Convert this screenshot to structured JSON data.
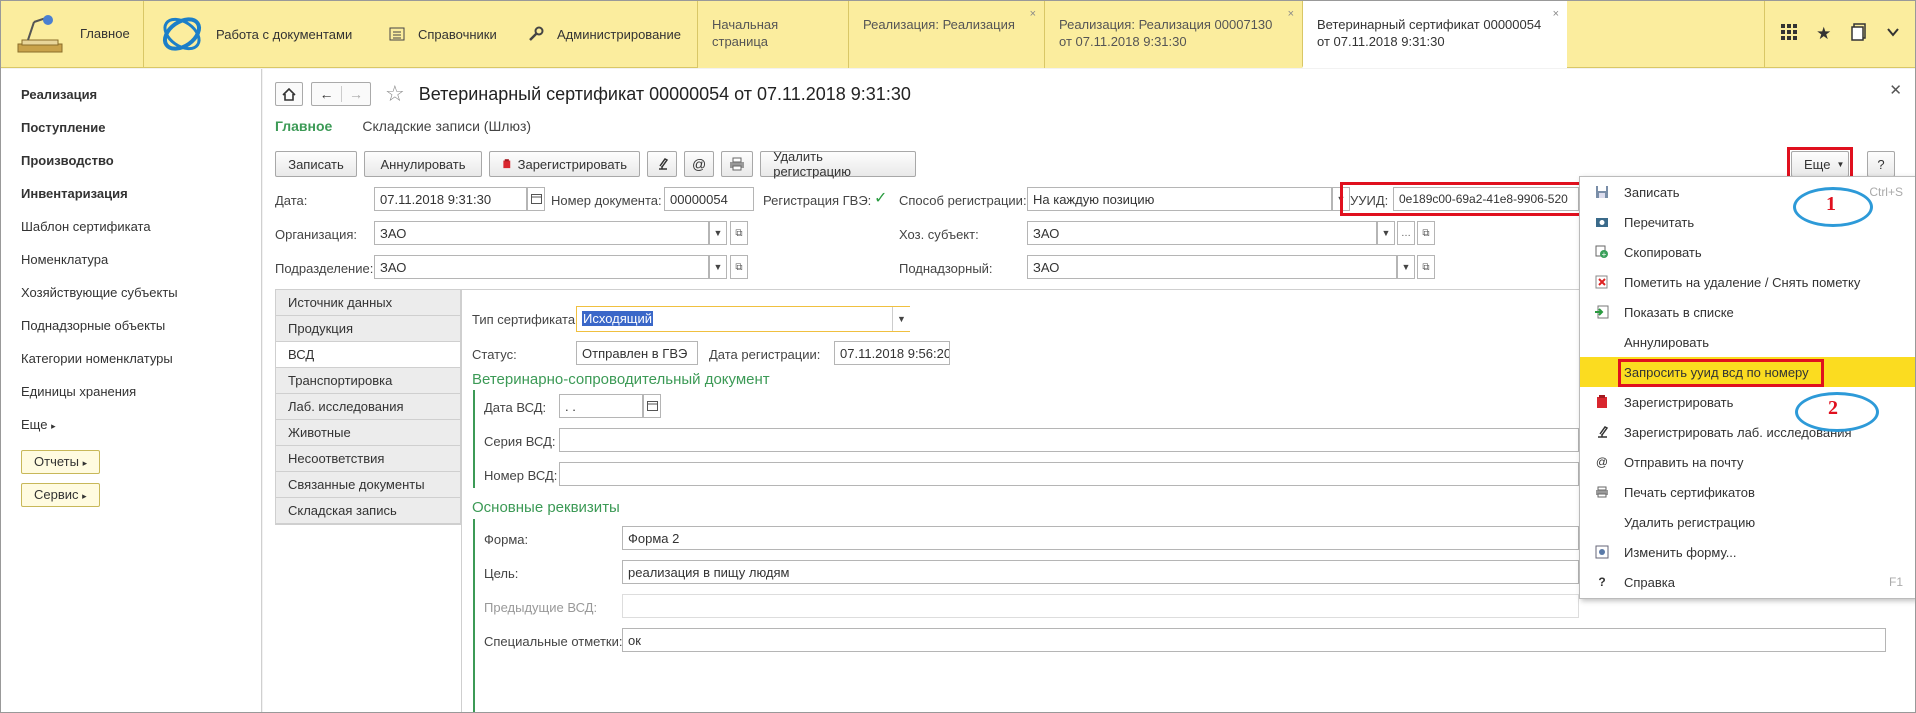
{
  "topbar": {
    "home_label": "Главное",
    "sections": [
      {
        "label": "Работа с документами",
        "icon": "orbit-logo-icon"
      },
      {
        "label": "Справочники",
        "icon": "list-icon"
      },
      {
        "label": "Администрирование",
        "icon": "wrench-icon"
      }
    ],
    "tabs": [
      {
        "label": "Начальная страница",
        "sub": ""
      },
      {
        "label": "Реализация: Реализация",
        "sub": ""
      },
      {
        "label": "Реализация: Реализация 00007130",
        "sub": "от 07.11.2018 9:31:30"
      },
      {
        "label": "Ветеринарный сертификат 00000054",
        "sub": "от 07.11.2018 9:31:30"
      }
    ],
    "close_glyph": "×"
  },
  "sidebar": {
    "items": [
      {
        "label": "Реализация",
        "bold": true
      },
      {
        "label": "Поступление",
        "bold": true
      },
      {
        "label": "Производство",
        "bold": true
      },
      {
        "label": "Инвентаризация",
        "bold": true
      },
      {
        "label": "Шаблон сертификата",
        "bold": false
      },
      {
        "label": "Номенклатура",
        "bold": false
      },
      {
        "label": "Хозяйствующие субъекты",
        "bold": false
      },
      {
        "label": "Поднадзорные объекты",
        "bold": false
      },
      {
        "label": "Категории номенклатуры",
        "bold": false
      },
      {
        "label": "Единицы хранения",
        "bold": false
      }
    ],
    "more_label": "Еще",
    "reports_label": "Отчеты",
    "service_label": "Сервис"
  },
  "form": {
    "title": "Ветеринарный сертификат 00000054 от 07.11.2018 9:31:30",
    "nav_main": "Главное",
    "nav_other": "Складские записи (Шлюз)",
    "buttons": {
      "save": "Записать",
      "cancel": "Аннулировать",
      "register": "Зарегистрировать",
      "delete_reg": "Удалить регистрацию",
      "more": "Еще",
      "help": "?"
    },
    "fields": {
      "date_label": "Дата:",
      "date_value": "07.11.2018  9:31:30",
      "docnum_label": "Номер документа:",
      "docnum_value": "00000054",
      "gve_label": "Регистрация ГВЭ:",
      "method_label": "Способ регистрации:",
      "method_value": "На каждую позицию",
      "uuid_label": "УУИД:",
      "uuid_value": "0e189c00-69a2-41e8-9906-520",
      "org_label": "Организация:",
      "org_value": "ЗАО",
      "hoz_label": "Хоз. субъект:",
      "hoz_value": "ЗАО",
      "dept_label": "Подразделение:",
      "dept_value": "ЗАО",
      "pod_label": "Поднадзорный:",
      "pod_value": "ЗАО"
    },
    "vtabs": [
      "Источник данных",
      "Продукция",
      "ВСД",
      "Транспортировка",
      "Лаб. исследования",
      "Животные",
      "Несоответствия",
      "Связанные документы",
      "Складская запись"
    ],
    "vsd": {
      "type_label": "Тип сертификата:",
      "type_value": "Исходящий",
      "status_label": "Статус:",
      "status_value": "Отправлен в ГВЭ",
      "regdate_label": "Дата регистрации:",
      "regdate_value": "07.11.2018  9:56:20",
      "section1": "Ветеринарно-сопроводительный документ",
      "vsd_date_label": "Дата ВСД:",
      "vsd_date_value": " .  .",
      "vsd_series_label": "Серия ВСД:",
      "vsd_number_label": "Номер ВСД:",
      "section2": "Основные реквизиты",
      "form_label": "Форма:",
      "form_value": "Форма 2",
      "goal_label": "Цель:",
      "goal_value": "реализация в пищу людям",
      "prev_label": "Предыдущие ВСД:",
      "special_label": "Специальные отметки:",
      "special_value": "ок"
    }
  },
  "menu": {
    "items": [
      {
        "label": "Записать",
        "icon": "save-icon",
        "shortcut": "Ctrl+S"
      },
      {
        "label": "Перечитать",
        "icon": "reread-icon",
        "shortcut": ""
      },
      {
        "label": "Скопировать",
        "icon": "copy-icon",
        "shortcut": ""
      },
      {
        "label": "Пометить на удаление / Снять пометку",
        "icon": "delete-mark-icon",
        "shortcut": ""
      },
      {
        "label": "Показать в списке",
        "icon": "show-in-list-icon",
        "shortcut": ""
      },
      {
        "label": "Аннулировать",
        "icon": "",
        "shortcut": ""
      },
      {
        "label": "Запросить ууид всд по номеру",
        "icon": "",
        "shortcut": ""
      },
      {
        "label": "Зарегистрировать",
        "icon": "register-icon",
        "shortcut": ""
      },
      {
        "label": "Зарегистрировать лаб. исследования",
        "icon": "microscope-icon",
        "shortcut": ""
      },
      {
        "label": "Отправить на почту",
        "icon": "at-icon",
        "shortcut": ""
      },
      {
        "label": "Печать сертификатов",
        "icon": "print-icon",
        "shortcut": ""
      },
      {
        "label": "Удалить регистрацию",
        "icon": "",
        "shortcut": ""
      },
      {
        "label": "Изменить форму...",
        "icon": "form-settings-icon",
        "shortcut": ""
      },
      {
        "label": "Справка",
        "icon": "help-icon",
        "shortcut": "F1"
      }
    ]
  },
  "annotations": {
    "one": "1",
    "two": "2"
  },
  "colors": {
    "accent_green": "#3c9a56",
    "topbar_yellow": "#fbed9e",
    "highlight_yellow": "#fbdc20",
    "annotation_red": "#e0101e",
    "annotation_blue": "#2d9ad8"
  }
}
